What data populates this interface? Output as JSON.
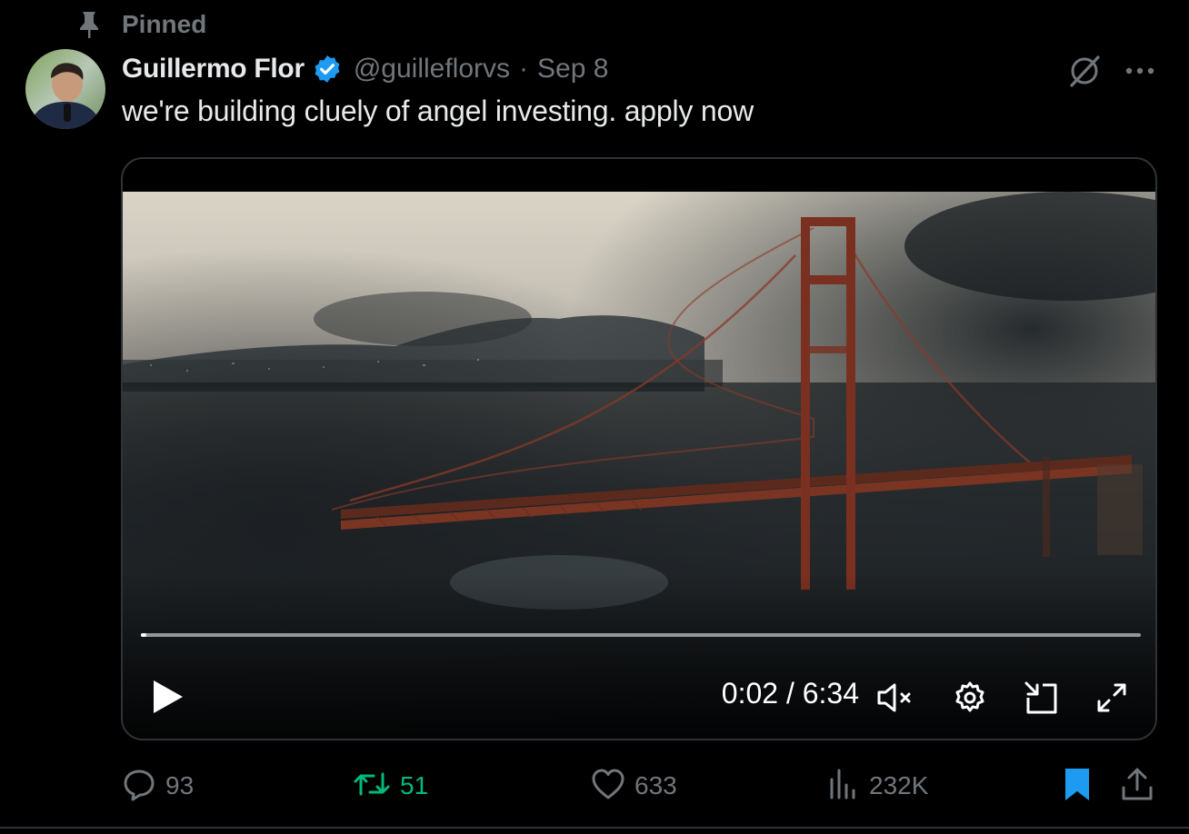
{
  "pinned": {
    "label": "Pinned"
  },
  "author": {
    "display_name": "Guillermo Flor",
    "handle": "@guilleflorvs",
    "separator": "·",
    "date": "Sep 8",
    "verified": true
  },
  "tweet": {
    "text": "we're building cluely of angel investing. apply now"
  },
  "video": {
    "current_time": "0:02",
    "duration": "6:34",
    "time_display": "0:02 / 6:34",
    "progress": 0.005,
    "muted": true
  },
  "engagement": {
    "replies": "93",
    "reposts": "51",
    "likes": "633",
    "views": "232K",
    "bookmarked": true
  },
  "colors": {
    "background": "#000000",
    "text_primary": "#e7e9ea",
    "text_secondary": "#71767b",
    "verified_blue": "#1d9bf0",
    "repost_green": "#00ba7c",
    "border": "#2f3336"
  }
}
